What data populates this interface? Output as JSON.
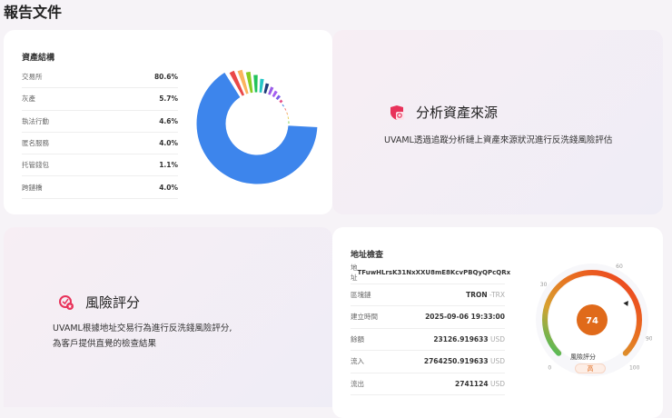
{
  "page_title": "報告文件",
  "asset_structure": {
    "title": "資產結構",
    "items": [
      {
        "label": "交易所",
        "value": "80.6%"
      },
      {
        "label": "灰產",
        "value": "5.7%"
      },
      {
        "label": "執法行動",
        "value": "4.6%"
      },
      {
        "label": "匿名服務",
        "value": "4.0%"
      },
      {
        "label": "托管錢包",
        "value": "1.1%"
      },
      {
        "label": "跨鏈橋",
        "value": "4.0%"
      }
    ]
  },
  "chart_data": {
    "type": "pie",
    "title": "資產結構",
    "categories": [
      "交易所",
      "灰產",
      "執法行動",
      "匿名服務",
      "托管錢包",
      "跨鏈橋"
    ],
    "values": [
      80.6,
      5.7,
      4.6,
      4.0,
      1.1,
      4.0
    ],
    "colors": [
      "#3d85ec",
      "#ea4848",
      "#fbb45e",
      "#88cc22",
      "#22c25a",
      "#25c6c6",
      "#1e3c78",
      "#9a5ce8",
      "#a55ef0",
      "#7a5de8",
      "#e6508a",
      "#3f7ee8",
      "#f08080",
      "#f5b070",
      "#e8d060",
      "#88d060"
    ]
  },
  "source_analysis": {
    "icon": "shield-search-icon",
    "title": "分析資產來源",
    "description": "UVAML透過追蹤分析鏈上資產來源狀況進行反洗錢風險評估"
  },
  "risk_score": {
    "icon": "risk-badge-icon",
    "title": "風險評分",
    "description_line1": "UVAML根據地址交易行為進行反洗錢風險評分,",
    "description_line2": "為客戶提供直覺的檢查結果"
  },
  "address_check": {
    "title": "地址檢查",
    "rows": [
      {
        "label": "地址",
        "value": "TFuwHLrsK31NxXXU8mE8KcvPBQyQPcQRx",
        "unit": ""
      },
      {
        "label": "區塊鏈",
        "value": "TRON",
        "unit": "-TRX"
      },
      {
        "label": "建立時間",
        "value": "2025-09-06 19:33:00",
        "unit": ""
      },
      {
        "label": "餘額",
        "value": "23126.919633",
        "unit": "USD"
      },
      {
        "label": "流入",
        "value": "2764250.919633",
        "unit": "USD"
      },
      {
        "label": "流出",
        "value": "2741124",
        "unit": "USD"
      }
    ]
  },
  "gauge": {
    "score": "74",
    "score_value": 74,
    "min": 0,
    "max": 100,
    "ticks": [
      "0",
      "30",
      "60",
      "90",
      "100"
    ],
    "label": "風險評分",
    "level": "高",
    "accent": "#e06a1a"
  }
}
